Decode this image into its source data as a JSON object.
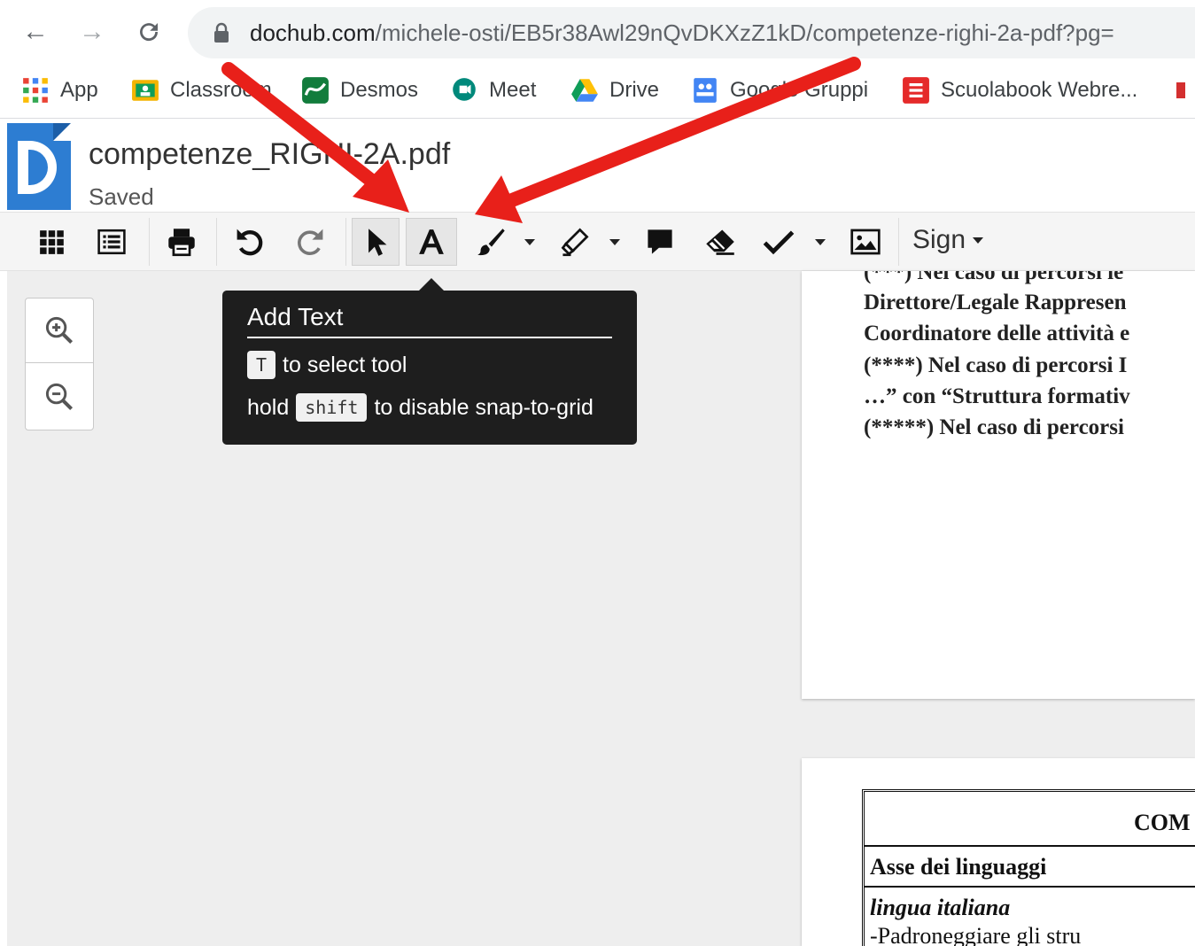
{
  "browser": {
    "url_domain": "dochub.com",
    "url_path": "/michele-osti/EB5r38Awl29nQvDKXzZ1kD/competenze-righi-2a-pdf?pg=",
    "bookmarks": [
      {
        "label": "App",
        "icon": "apps-grid-icon"
      },
      {
        "label": "Classroom",
        "icon": "classroom-icon"
      },
      {
        "label": "Desmos",
        "icon": "desmos-icon"
      },
      {
        "label": "Meet",
        "icon": "meet-icon"
      },
      {
        "label": "Drive",
        "icon": "drive-icon"
      },
      {
        "label": "Google Gruppi",
        "icon": "groups-icon"
      },
      {
        "label": "Scuolabook Webre...",
        "icon": "scuolabook-icon"
      }
    ]
  },
  "document": {
    "title": "competenze_RIGHI-2A.pdf",
    "status": "Saved"
  },
  "toolbar": {
    "sign_label": "Sign",
    "tools": [
      "grid-view-icon",
      "list-view-icon",
      "print-icon",
      "undo-icon",
      "redo-icon",
      "select-pointer-icon",
      "add-text-icon",
      "brush-icon",
      "highlighter-icon",
      "comment-icon",
      "eraser-icon",
      "checkmark-icon",
      "image-icon"
    ]
  },
  "tooltip": {
    "title": "Add Text",
    "key1": "T",
    "text1": "to select tool",
    "prefix2": "hold",
    "key2": "shift",
    "text2": "to disable snap-to-grid"
  },
  "page1": {
    "lines": [
      "(***) Nel caso di percorsi ie",
      "Direttore/Legale Rappresen",
      "Coordinatore delle attività e",
      "(****) Nel caso di percorsi I",
      "…” con “Struttura formativ",
      "(*****) Nel caso di percorsi"
    ]
  },
  "page2": {
    "header": "COM",
    "row1": "Asse dei linguaggi",
    "row2": "lingua italiana",
    "row3": "-Padroneggiare gli stru"
  },
  "colors": {
    "annotation_arrow": "#e8201a",
    "dochub_blue": "#2d7dd2",
    "tooltip_bg": "#1e1e1e"
  }
}
